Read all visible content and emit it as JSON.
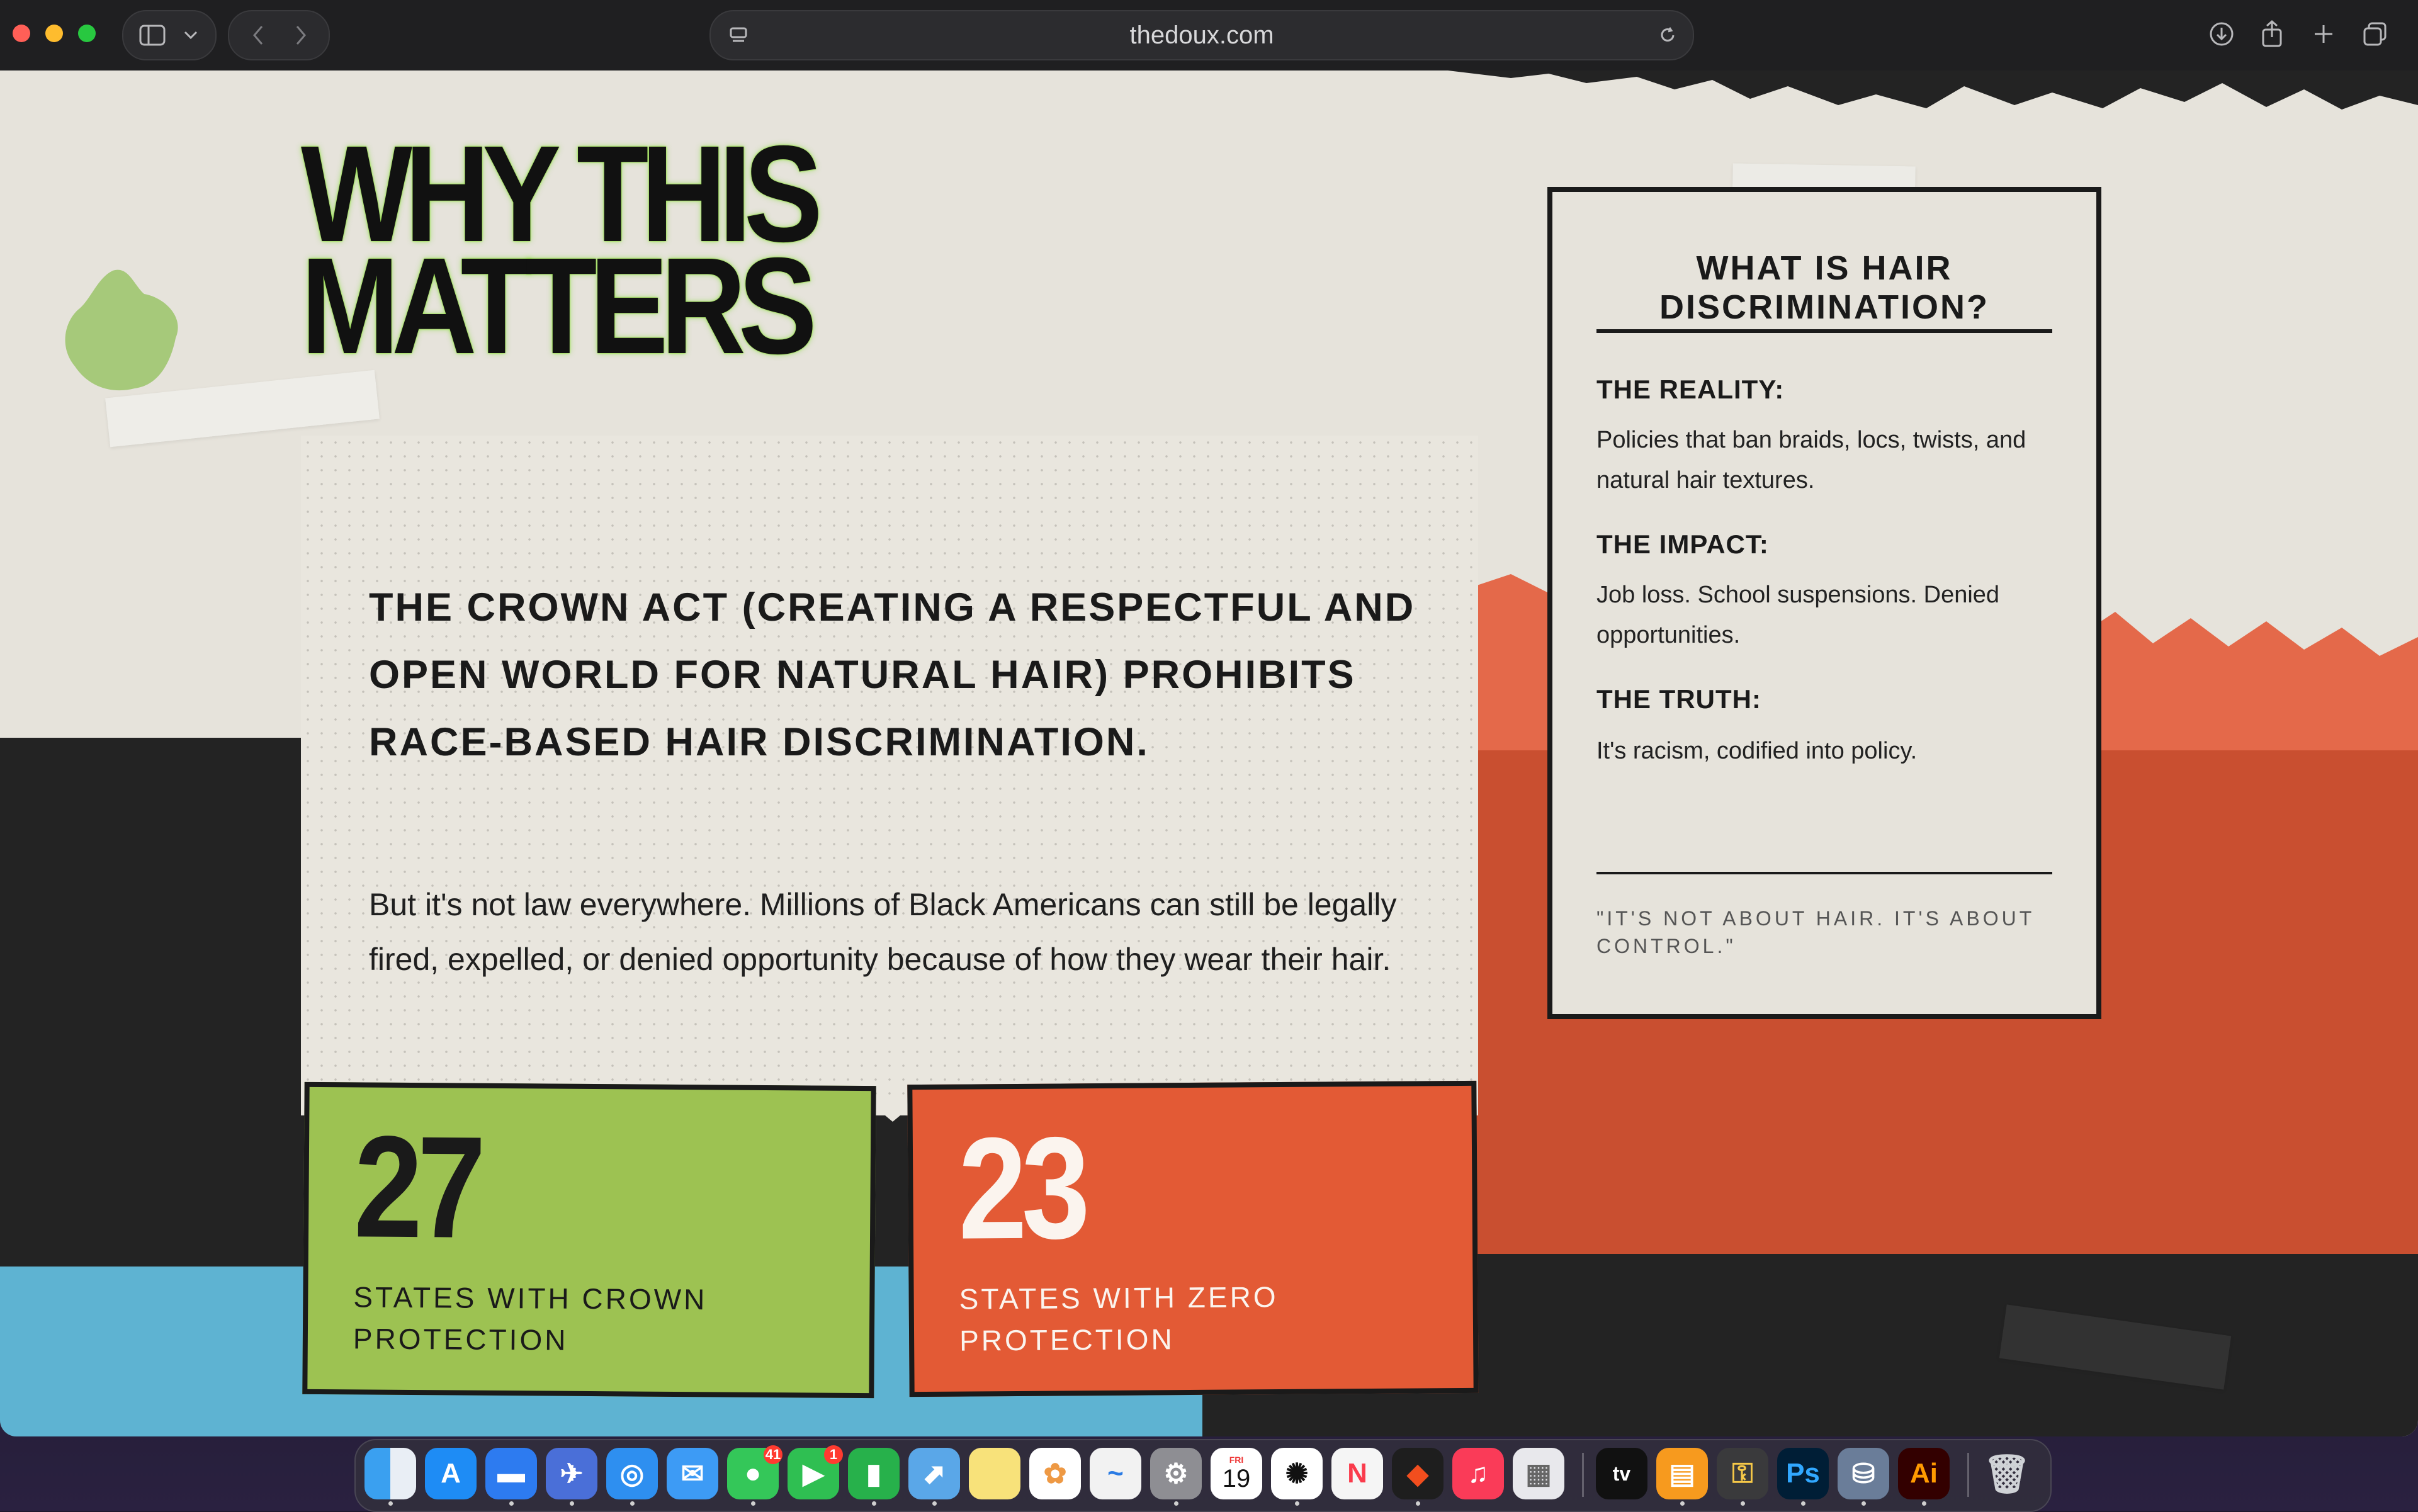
{
  "browser": {
    "url": "thedoux.com"
  },
  "page": {
    "title": "WHY THIS MATTERS",
    "crown_heading": "THE CROWN ACT (CREATING A RESPECTFUL AND OPEN WORLD FOR NATURAL HAIR) PROHIBITS RACE-BASED HAIR DISCRIMINATION.",
    "crown_body": "But it's not law everywhere. Millions of Black Americans can still be legally fired, expelled, or denied opportunity because of how they wear their hair.",
    "stats": [
      {
        "value": "27",
        "label": "STATES WITH CROWN PROTECTION"
      },
      {
        "value": "23",
        "label": "STATES WITH ZERO PROTECTION"
      }
    ],
    "info_box": {
      "title": "WHAT IS HAIR DISCRIMINATION?",
      "sections": [
        {
          "label": "THE REALITY:",
          "text": "Policies that ban braids, locs, twists, and natural hair textures."
        },
        {
          "label": "THE IMPACT:",
          "text": "Job loss. School suspensions. Denied opportunities."
        },
        {
          "label": "THE TRUTH:",
          "text": "It's racism, codified into policy."
        }
      ],
      "quote": "\"IT'S NOT ABOUT HAIR. IT'S ABOUT CONTROL.\""
    }
  },
  "colors": {
    "green": "#9dc252",
    "orange_red": "#e35a35",
    "dark": "#232323",
    "cream": "#e6e3db",
    "blue": "#5eb3d2",
    "glow": "#9be04f"
  },
  "dock": {
    "apps": [
      {
        "name": "finder-icon"
      },
      {
        "name": "app-store-icon"
      },
      {
        "name": "keynote-icon"
      },
      {
        "name": "mail-send-icon"
      },
      {
        "name": "safari-icon"
      },
      {
        "name": "mail-icon"
      },
      {
        "name": "messages-icon",
        "badge": "41"
      },
      {
        "name": "facetime-icon",
        "badge": "1"
      },
      {
        "name": "numbers-icon"
      },
      {
        "name": "maps-icon"
      },
      {
        "name": "notes-icon"
      },
      {
        "name": "photos-icon"
      },
      {
        "name": "freeform-icon"
      },
      {
        "name": "system-settings-icon"
      },
      {
        "name": "calendar-icon",
        "day": "FRI",
        "date": "19"
      },
      {
        "name": "chatgpt-icon"
      },
      {
        "name": "news-icon"
      },
      {
        "name": "figma-icon"
      },
      {
        "name": "music-icon"
      },
      {
        "name": "launchpad-icon"
      },
      {
        "name": "apple-tv-icon",
        "label": "tv"
      },
      {
        "name": "books-icon"
      },
      {
        "name": "keychain-icon"
      },
      {
        "name": "photoshop-icon",
        "label": "Ps"
      },
      {
        "name": "disk-utility-icon"
      },
      {
        "name": "illustrator-icon",
        "label": "Ai"
      },
      {
        "name": "trash-icon"
      }
    ]
  }
}
